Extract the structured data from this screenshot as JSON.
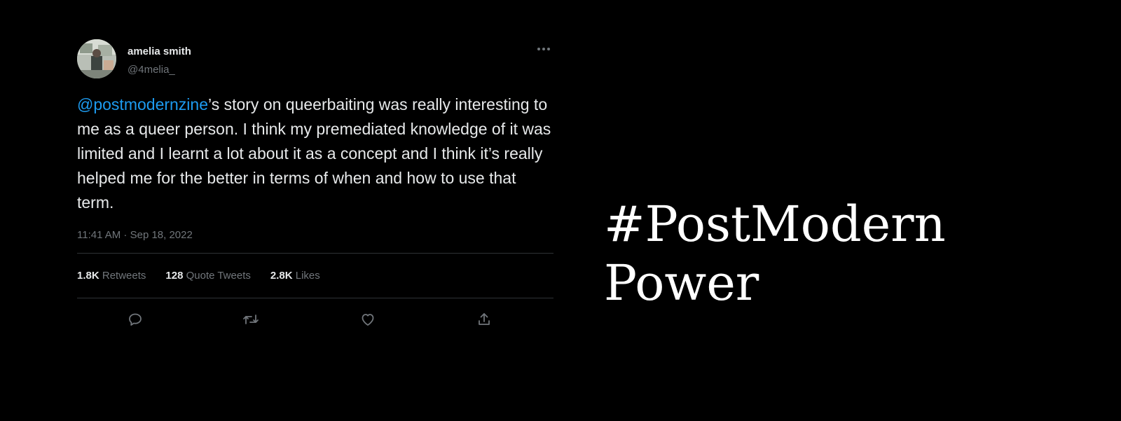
{
  "tweet": {
    "author": {
      "name": "amelia smith",
      "handle": "@4melia_"
    },
    "text": {
      "mention": "@postmodernzine",
      "body": "’s story on queerbaiting was really interesting to me as a queer person. I think my premediated knowledge of it was limited and I learnt a lot about it as a concept and I think it’s really helped me for the better in terms of when and how to use that term."
    },
    "timestamp": "11:41 AM · Sep 18, 2022",
    "stats": {
      "retweets_count": "1.8K",
      "retweets_label": "Retweets",
      "quotes_count": "128",
      "quotes_label": "Quote Tweets",
      "likes_count": "2.8K",
      "likes_label": "Likes"
    },
    "actions": {
      "reply_icon": "reply-icon",
      "retweet_icon": "retweet-icon",
      "like_icon": "heart-icon",
      "share_icon": "share-icon",
      "more_icon": "more-icon"
    }
  },
  "headline": {
    "line1": "#PostModern",
    "line2": "Power"
  },
  "colors": {
    "background": "#000000",
    "text": "#e7e9ea",
    "secondary_text": "#71767b",
    "mention": "#1d9bf0",
    "divider": "#2f3336",
    "headline": "#ffffff"
  }
}
